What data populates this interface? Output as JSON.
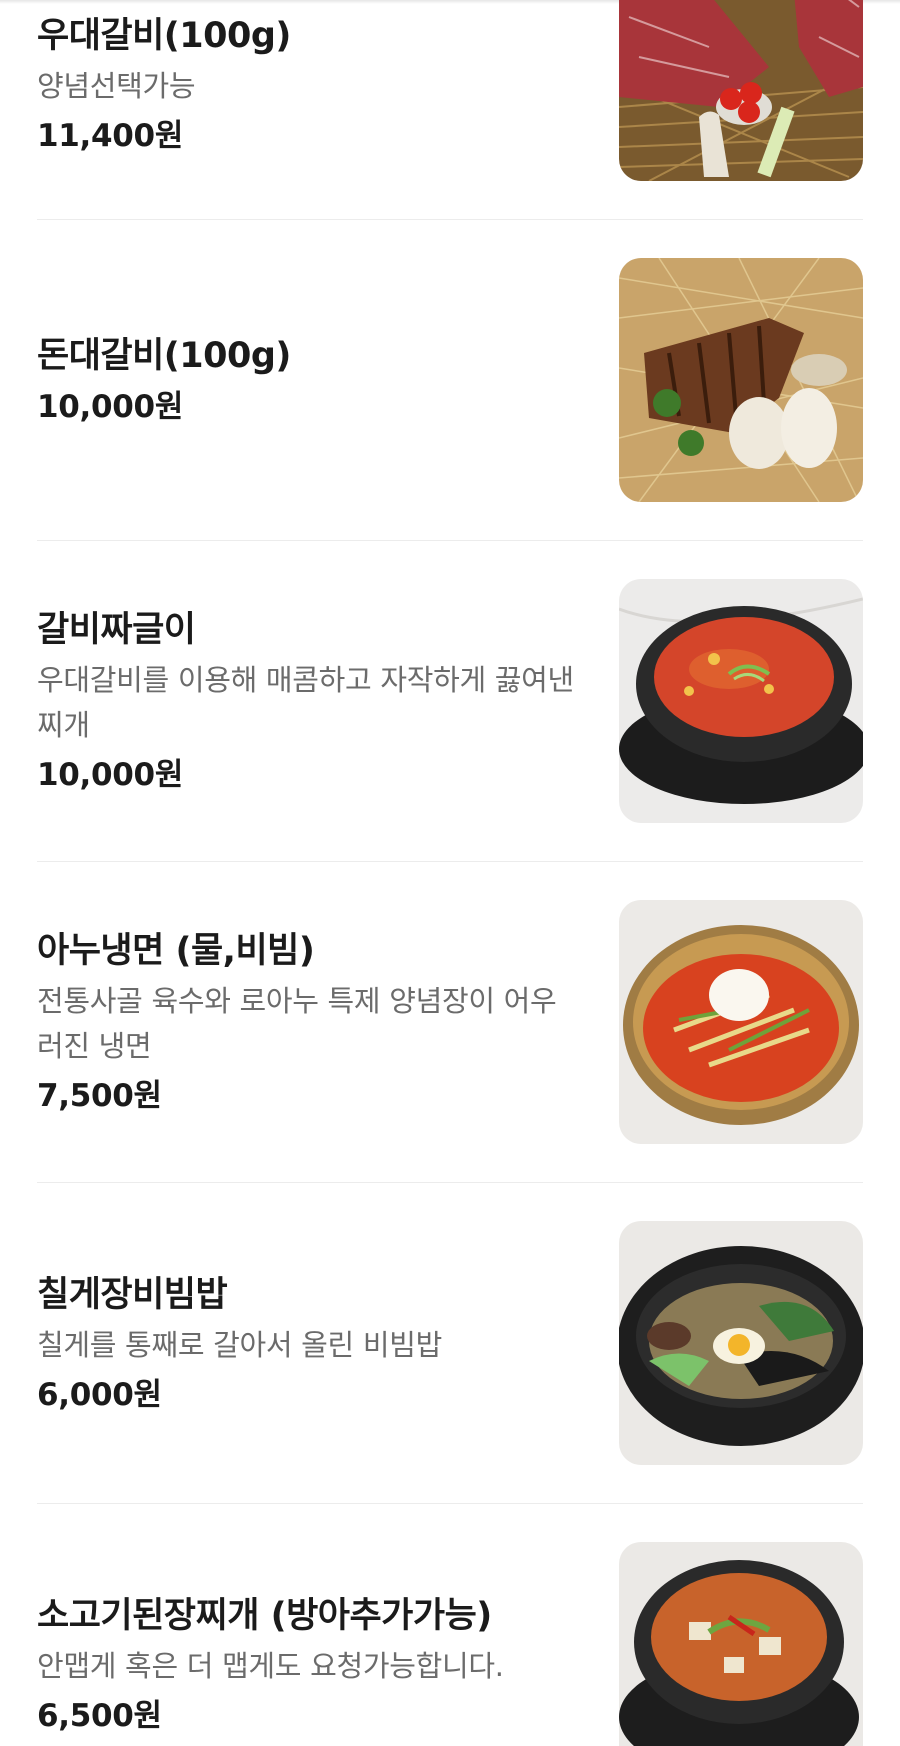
{
  "menu": {
    "items": [
      {
        "name": "우대갈비(100g)",
        "description": "양념선택가능",
        "price": "11,400원",
        "image_icon": "beef-short-rib-photo"
      },
      {
        "name": "돈대갈비(100g)",
        "description": "",
        "price": "10,000원",
        "image_icon": "pork-rib-photo"
      },
      {
        "name": "갈비짜글이",
        "description": "우대갈비를 이용해 매콤하고 자작하게 끓여낸 찌개",
        "price": "10,000원",
        "image_icon": "spicy-stew-photo"
      },
      {
        "name": "아누냉면 (물,비빔)",
        "description": "전통사골 육수와 로아누 특제 양념장이 어우러진 냉면",
        "price": "7,500원",
        "image_icon": "cold-noodles-photo"
      },
      {
        "name": "칠게장비빔밥",
        "description": "칠게를 통째로 갈아서 올린 비빔밥",
        "price": "6,000원",
        "image_icon": "bibimbap-photo"
      },
      {
        "name": "소고기된장찌개 (방아추가가능)",
        "description": "안맵게 혹은 더 맵게도 요청가능합니다.",
        "price": "6,500원",
        "image_icon": "soybean-stew-photo"
      }
    ]
  },
  "colors": {
    "text_primary": "#1b1b1b",
    "text_secondary": "#6b6b6b",
    "divider": "#ececec"
  }
}
